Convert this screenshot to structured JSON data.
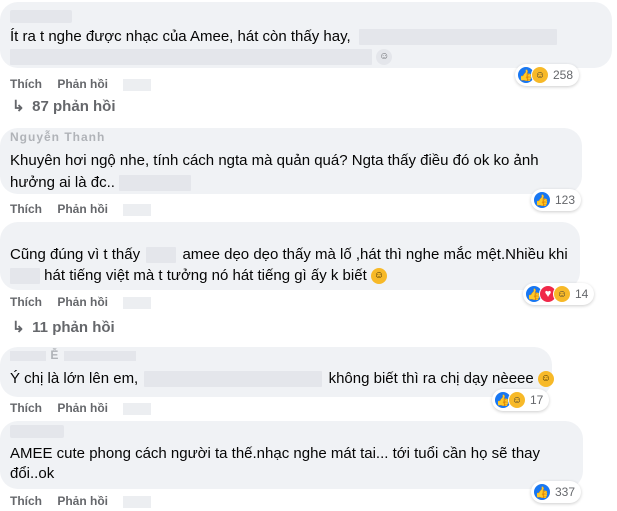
{
  "labels": {
    "like": "Thích",
    "reply": "Phản hồi"
  },
  "comments": [
    {
      "author": "",
      "text_line1": "Ít ra t nghe được nhạc của Amee, hát còn thấy hay,",
      "reaction_count": "258",
      "reactions": [
        "like-icon",
        "haha-icon"
      ],
      "replies_label": "87 phản hồi"
    },
    {
      "author": "Nguyễn Thanh",
      "text_line1": "Khuyên hơi ngộ nhe, tính cách ngta mà quản quá? Ngta thấy điều đó ok ko ảnh",
      "text_line2": "hưởng ai là đc..",
      "reaction_count": "123",
      "reactions": [
        "like-icon"
      ]
    },
    {
      "author": "",
      "text_line1_a": "Cũng đúng vì t thấy",
      "text_line1_b": "amee dẹo dẹo thấy mà lố ,hát thì nghe mắc mệt.Nhiều khi",
      "text_line2": "hát tiếng việt mà t tưởng nó hát tiếng gì ấy k biết",
      "reaction_count": "14",
      "reactions": [
        "like-icon",
        "love-icon",
        "haha-icon"
      ],
      "replies_label": "11 phản hồi"
    },
    {
      "author": "Ễ",
      "text_line1_a": "Ý chị là lớn lên em,",
      "text_line1_b": "không biết thì ra chị dạy nèeee",
      "reaction_count": "17",
      "reactions": [
        "like-icon",
        "haha-icon"
      ]
    },
    {
      "author": "",
      "text_line1": "AMEE cute phong cách người ta thế.nhạc nghe mát tai... tới tuổi cần họ sẽ thay",
      "text_line2": "đổi..ok",
      "reaction_count": "337",
      "reactions": [
        "like-icon"
      ]
    }
  ],
  "colors": {
    "bubble": "#f0f2f5",
    "like": "#1877f2",
    "haha": "#f7b928",
    "love": "#f02849",
    "meta": "#65676b"
  }
}
